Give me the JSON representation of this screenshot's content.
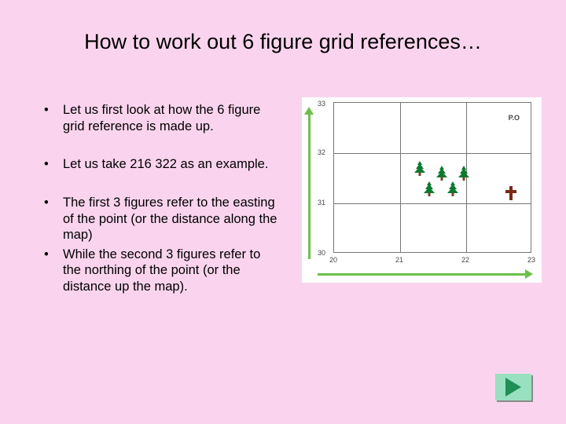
{
  "title": "How to work out 6 figure grid references…",
  "bullets": {
    "b1": "Let us first look at how the 6 figure grid reference is made up.",
    "b2": "Let us take 216  322 as an example.",
    "b3": "The first 3 figures  refer to the easting of the point (or the distance along the map)",
    "b4": "While the second 3 figures refer to the northing of the point (or the distance up the map)."
  },
  "grid": {
    "po_label": "P.O",
    "xlabels": {
      "x20": "20",
      "x21": "21",
      "x22": "22",
      "x23": "23"
    },
    "ylabels": {
      "y30": "30",
      "y31": "31",
      "y32": "32",
      "y33": "33"
    }
  }
}
